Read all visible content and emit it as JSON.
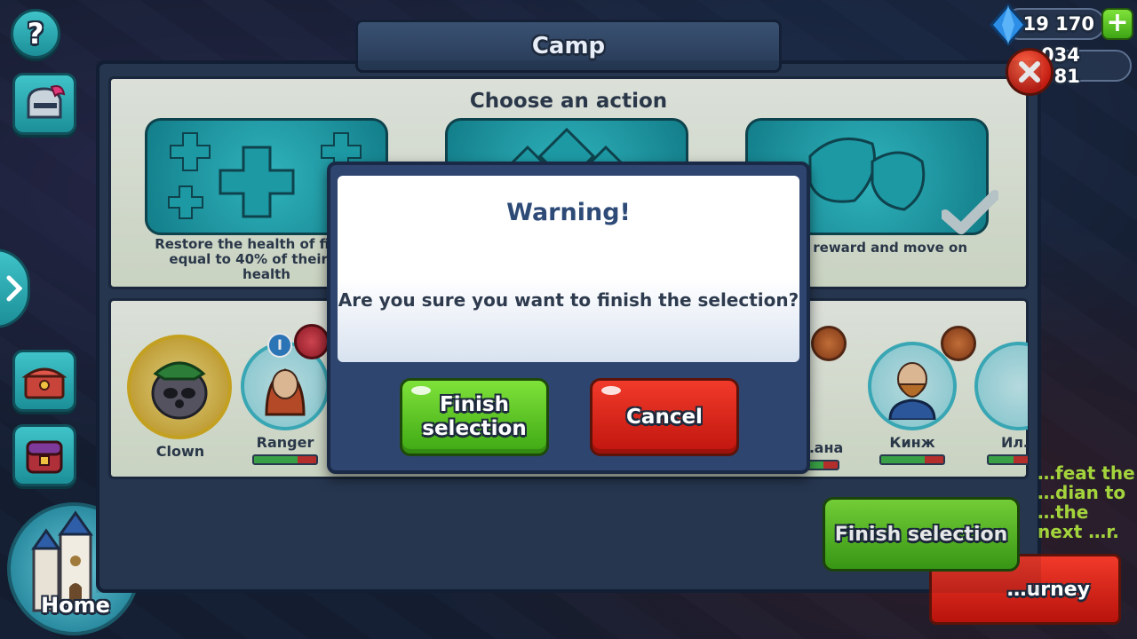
{
  "camp": {
    "title": "Camp",
    "choose_title": "Choose an action",
    "actions": [
      {
        "icon": "plus-icon",
        "description": "Restore the health of fighters equal to 40% of their max health"
      },
      {
        "icon": "tiles-icon",
        "description": ""
      },
      {
        "icon": "gem-pile-icon",
        "description": "Claim reward and move on"
      }
    ],
    "heroes": [
      {
        "name": "Clown",
        "hp": 1.0,
        "hp_shown": false
      },
      {
        "name": "Ranger",
        "hp": 0.7,
        "hp_shown": true,
        "level_badge": "I"
      },
      {
        "name": "…ана",
        "hp": 0.55,
        "hp_shown": true
      },
      {
        "name": "Кинж",
        "hp": 0.7,
        "hp_shown": true
      },
      {
        "name": "Ил…",
        "hp": 0.5,
        "hp_shown": true
      }
    ],
    "hint_text": "…feat the …dian to …the next …r.",
    "finish_label": "Finish selection",
    "journey_label": "…urney"
  },
  "currencies": {
    "gems": "19 170",
    "gold": "034 981"
  },
  "hud": {
    "help_label": "?",
    "home_label": "Home"
  },
  "modal": {
    "title": "Warning!",
    "message": "Are you sure you want to finish the selection?",
    "finish_button": "Finish selection",
    "cancel_button": "Cancel"
  },
  "colors": {
    "accent_teal": "#34c6cf",
    "finish_green": "#5cc925",
    "cancel_red": "#d8201a",
    "panel_navy": "#2e4570"
  }
}
